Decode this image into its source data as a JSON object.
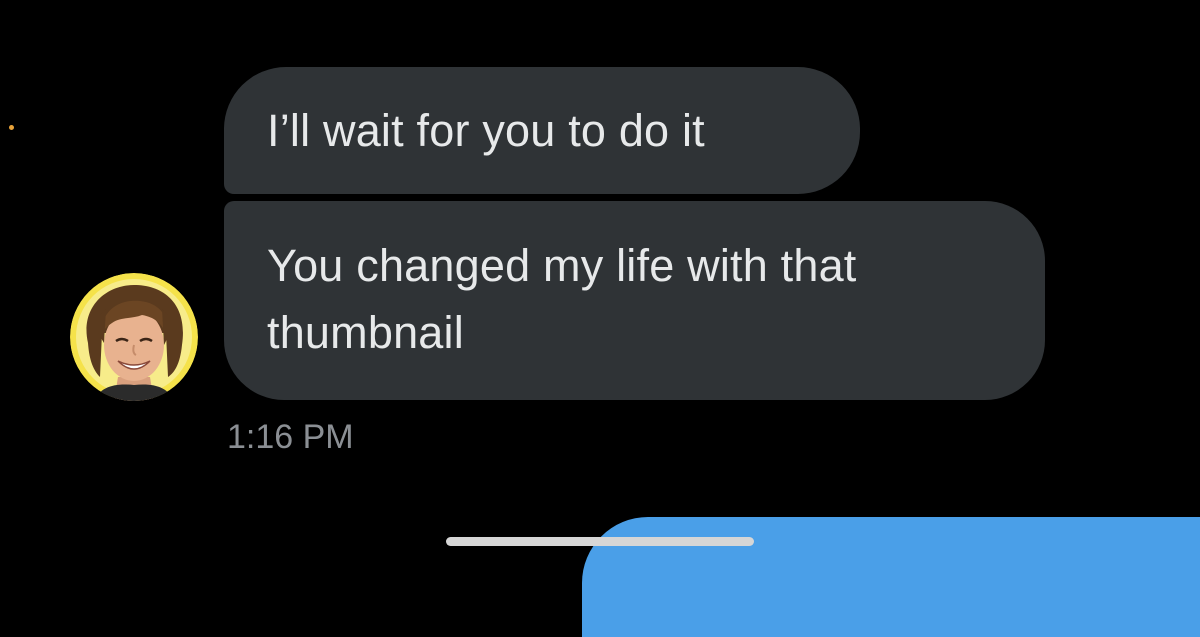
{
  "conversation": {
    "messages": [
      {
        "text": "I’ll wait for you to do it"
      },
      {
        "text": "You changed my life with that thumbnail"
      }
    ],
    "timestamp": "1:16 PM"
  },
  "sender": {
    "avatar": "profile-photo-smiling-person"
  },
  "colors": {
    "background": "#000000",
    "incoming_bubble": "#2f3336",
    "outgoing_bubble": "#4a9fe8",
    "avatar_ring": "#f5e24a",
    "timestamp_text": "#8b8f94"
  }
}
